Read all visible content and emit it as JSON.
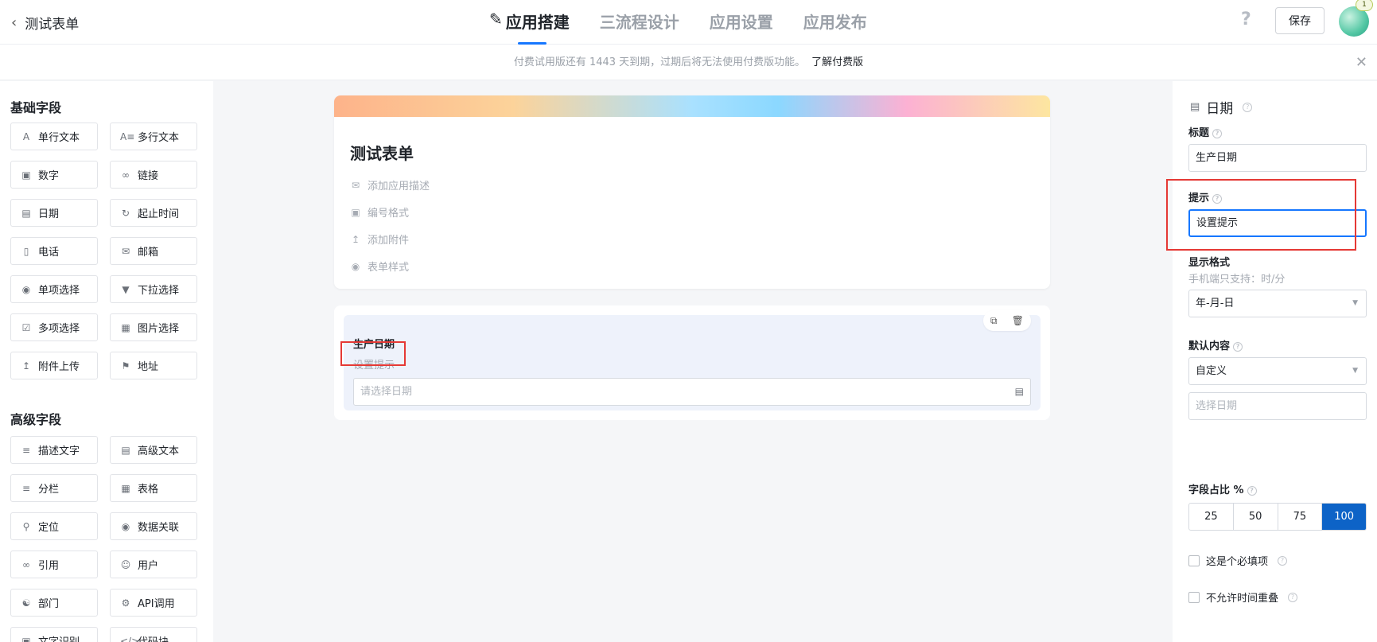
{
  "header": {
    "back_label": "测试表单",
    "tabs": [
      {
        "label": "应用搭建",
        "icon": "edit-icon",
        "active": true
      },
      {
        "label": "三流程设计",
        "active": false
      },
      {
        "label": "应用设置",
        "active": false
      },
      {
        "label": "应用发布",
        "active": false
      }
    ],
    "help_label": "?",
    "save_label": "保存",
    "avatar_badge": "1"
  },
  "notice": {
    "text": "付费试用版还有 1443 天到期，过期后将无法使用付费版功能。",
    "link": "了解付费版"
  },
  "palette": {
    "basic_title": "基础字段",
    "advanced_title": "高级字段",
    "basic": [
      {
        "label": "单行文本",
        "icon": "single-text-icon"
      },
      {
        "label": "多行文本",
        "icon": "multi-text-icon"
      },
      {
        "label": "数字",
        "icon": "number-icon"
      },
      {
        "label": "链接",
        "icon": "link-icon"
      },
      {
        "label": "日期",
        "icon": "date-icon"
      },
      {
        "label": "起止时间",
        "icon": "time-range-icon"
      },
      {
        "label": "电话",
        "icon": "phone-icon"
      },
      {
        "label": "邮箱",
        "icon": "mail-icon"
      },
      {
        "label": "单项选择",
        "icon": "radio-icon"
      },
      {
        "label": "下拉选择",
        "icon": "dropdown-icon"
      },
      {
        "label": "多项选择",
        "icon": "checkbox-icon"
      },
      {
        "label": "图片选择",
        "icon": "image-icon"
      },
      {
        "label": "附件上传",
        "icon": "upload-icon"
      },
      {
        "label": "地址",
        "icon": "address-icon"
      }
    ],
    "advanced": [
      {
        "label": "描述文字",
        "icon": "description-icon"
      },
      {
        "label": "高级文本",
        "icon": "rich-text-icon"
      },
      {
        "label": "分栏",
        "icon": "columns-icon"
      },
      {
        "label": "表格",
        "icon": "table-icon"
      },
      {
        "label": "定位",
        "icon": "location-icon"
      },
      {
        "label": "数据关联",
        "icon": "data-link-icon"
      },
      {
        "label": "引用",
        "icon": "reference-icon"
      },
      {
        "label": "用户",
        "icon": "user-icon"
      },
      {
        "label": "部门",
        "icon": "department-icon"
      },
      {
        "label": "API调用",
        "icon": "api-icon"
      },
      {
        "label": "文字识别",
        "icon": "ocr-icon"
      },
      {
        "label": "代码块",
        "icon": "code-icon"
      }
    ]
  },
  "form": {
    "title": "测试表单",
    "meta": [
      {
        "label": "添加应用描述",
        "icon": "comment-icon"
      },
      {
        "label": "编号格式",
        "icon": "number-format-icon"
      },
      {
        "label": "添加附件",
        "icon": "upload-icon"
      },
      {
        "label": "表单样式",
        "icon": "palette-icon"
      }
    ],
    "field": {
      "label": "生产日期",
      "hint": "设置提示",
      "placeholder": "请选择日期"
    }
  },
  "props": {
    "type_label": "日期",
    "title_label": "标题",
    "title_value": "生产日期",
    "hint_label": "提示",
    "hint_value": "设置提示",
    "format_label": "显示格式",
    "format_note": "手机端只支持：时/分",
    "format_value": "年-月-日",
    "default_label": "默认内容",
    "default_value": "自定义",
    "default_date_placeholder": "选择日期",
    "width_label": "字段占比 %",
    "width_options": [
      "25",
      "50",
      "75",
      "100"
    ],
    "width_selected": "100",
    "required_label": "这是个必填项",
    "no_overlap_label": "不允许时间重叠"
  },
  "colors": {
    "accent": "#1677ff",
    "selected_segment": "#0d63c7",
    "highlight_box": "#e53935"
  }
}
